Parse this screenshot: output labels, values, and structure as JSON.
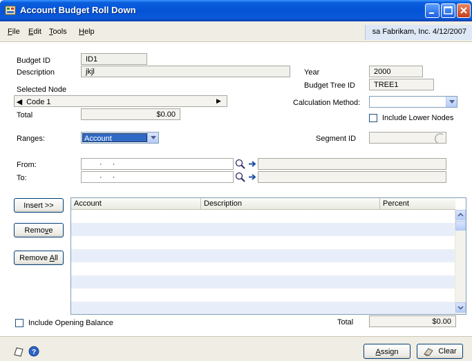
{
  "window": {
    "title": "Account Budget Roll Down"
  },
  "menu": {
    "items": [
      {
        "label": "File",
        "accel": "F"
      },
      {
        "label": "Edit",
        "accel": "E"
      },
      {
        "label": "Tools",
        "accel": "T"
      },
      {
        "label": "Help",
        "accel": "H"
      }
    ],
    "company_info": "sa  Fabrikam, Inc.  4/12/2007"
  },
  "form": {
    "budget_id_label": "Budget ID",
    "budget_id_value": "ID1",
    "description_label": "Description",
    "description_value": "jkjl",
    "year_label": "Year",
    "year_value": "2000",
    "budget_tree_id_label": "Budget Tree ID",
    "budget_tree_id_value": "TREE1",
    "selected_node_label": "Selected Node",
    "selected_node_value": "Code 1",
    "total_label": "Total",
    "total_value": "$0.00",
    "calc_method_label": "Calculation Method:",
    "calc_method_value": "",
    "include_lower_nodes_label": "Include Lower Nodes",
    "include_lower_nodes_checked": false,
    "ranges_label": "Ranges:",
    "ranges_value": "Account",
    "segment_id_label": "Segment ID",
    "from_label": "From:",
    "from_mask": "·  ·",
    "to_label": "To:",
    "to_mask": "·  ·"
  },
  "buttons": {
    "insert": "Insert >>",
    "remove": "Remove",
    "remove_all": "Remove All",
    "assign": "Assign",
    "clear": "Clear"
  },
  "grid": {
    "columns": [
      "Account",
      "Description",
      "Percent"
    ],
    "rows": []
  },
  "footer": {
    "include_opening_balance_label": "Include Opening Balance",
    "include_opening_balance_checked": false,
    "grid_total_label": "Total",
    "grid_total_value": "$0.00"
  },
  "icons": {
    "window": "window-app-icon",
    "lookup": "lookup-magnifier-icon",
    "expand": "expand-arrow-icon",
    "note": "note-icon",
    "help": "help-icon",
    "clear": "eraser-icon"
  },
  "colors": {
    "titlebar": "#0453d6",
    "grid_alt_row": "#e8eef9",
    "company_bg": "#dde7f6"
  }
}
